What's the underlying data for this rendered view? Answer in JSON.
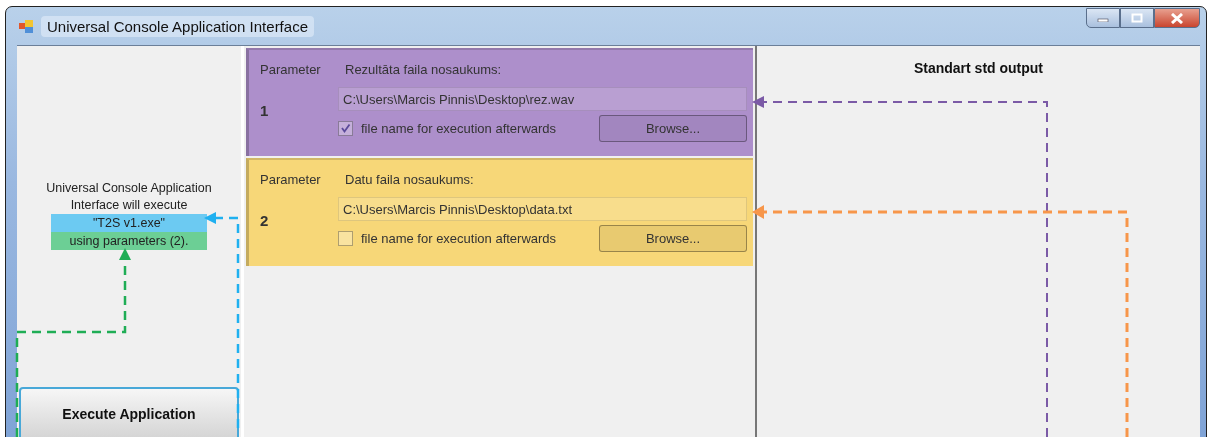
{
  "window": {
    "title": "Universal Console Application Interface"
  },
  "summary": {
    "text": "Universal Console Application Interface will execute",
    "program": "\"T2S v1.exe\"",
    "note": "using parameters (2)."
  },
  "execute_button": "Execute Application",
  "parameters": [
    {
      "label": "Parameter",
      "number": "1",
      "title": "Rezultāta faila nosaukums:",
      "value": "C:\\Users\\Marcis Pinnis\\Desktop\\rez.wav",
      "checkbox_label": "file name for execution afterwards",
      "checked": true,
      "browse": "Browse...",
      "color": "#ad8fcb"
    },
    {
      "label": "Parameter",
      "number": "2",
      "title": "Datu faila nosaukums:",
      "value": "C:\\Users\\Marcis Pinnis\\Desktop\\data.txt",
      "checkbox_label": "file name for execution afterwards",
      "checked": false,
      "browse": "Browse...",
      "color": "#f7d778"
    }
  ],
  "output": {
    "title": "Standart std output"
  }
}
